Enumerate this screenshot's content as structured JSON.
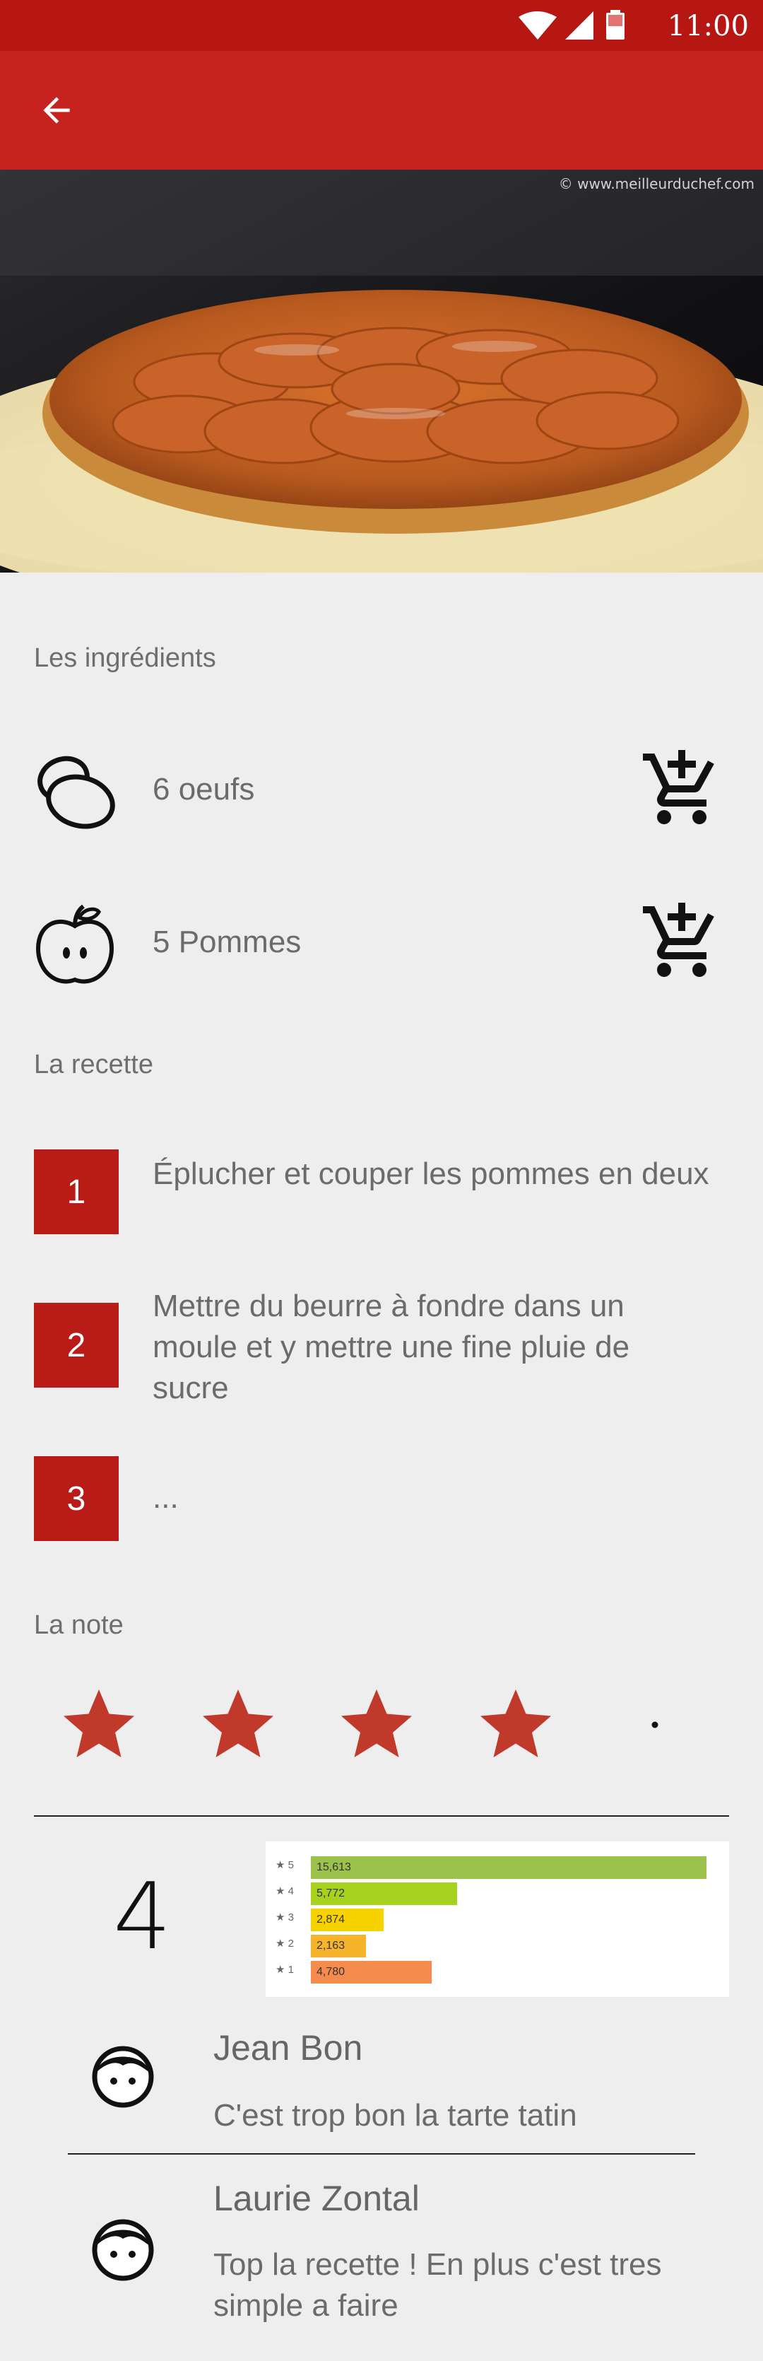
{
  "status_bar": {
    "time": "11:00",
    "icons": [
      "wifi-icon",
      "signal-icon",
      "battery-icon"
    ]
  },
  "app_bar": {
    "back_icon": "arrow-left-icon",
    "color": "#c62320"
  },
  "hero": {
    "watermark": "© www.meilleurduchef.com"
  },
  "ingredients": {
    "title": "Les ingrédients",
    "items": [
      {
        "label": "6 oeufs",
        "icon": "egg-icon",
        "action_icon": "add-to-cart-icon"
      },
      {
        "label": "5 Pommes",
        "icon": "apple-icon",
        "action_icon": "add-to-cart-icon"
      }
    ]
  },
  "recipe": {
    "title": "La recette",
    "steps": [
      {
        "number": "1",
        "text": "Éplucher et couper les pommes en deux"
      },
      {
        "number": "2",
        "text": "Mettre du beurre à fondre dans un moule et y mettre une fine pluie de sucre"
      },
      {
        "number": "3",
        "text": "..."
      }
    ]
  },
  "rating": {
    "title": "La note",
    "value": 4,
    "max": 5,
    "average_display": "4",
    "star_color": "#c0392b",
    "distribution": [
      {
        "stars": "★ 5",
        "count": "15,613",
        "value": 15613,
        "color": "#9bc24a"
      },
      {
        "stars": "★ 4",
        "count": "5,772",
        "value": 5772,
        "color": "#a6d21e"
      },
      {
        "stars": "★ 3",
        "count": "2,874",
        "value": 2874,
        "color": "#f6d200"
      },
      {
        "stars": "★ 2",
        "count": "2,163",
        "value": 2163,
        "color": "#f6b42a"
      },
      {
        "stars": "★ 1",
        "count": "4,780",
        "value": 4780,
        "color": "#f58b4c"
      }
    ]
  },
  "reviews": [
    {
      "name": "Jean Bon",
      "comment": "C'est trop bon la tarte tatin",
      "avatar_icon": "user-face-icon"
    },
    {
      "name": "Laurie Zontal",
      "comment": "Top la recette ! En plus c'est tres simple a faire",
      "avatar_icon": "user-face-icon"
    }
  ]
}
